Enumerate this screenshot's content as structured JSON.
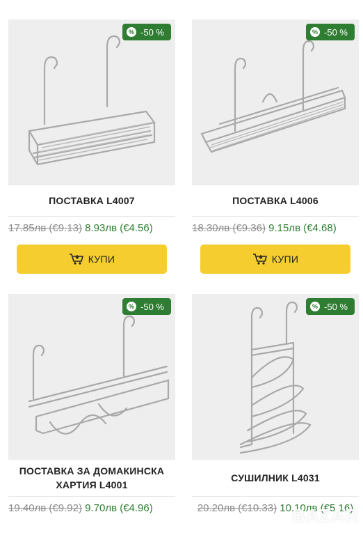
{
  "colors": {
    "badge": "#2e7d32",
    "buy_button": "#f6cd2f",
    "new_price": "#2e7d32",
    "old_price": "#8a8a8a"
  },
  "products": [
    {
      "badge": "-50 %",
      "title": "ПОСТАВКА L4007",
      "old_price": "17.85лв (€9.13)",
      "new_price": "8.93лв (€4.56)",
      "buy_label": "КУПИ"
    },
    {
      "badge": "-50 %",
      "title": "ПОСТАВКА L4006",
      "old_price": "18.30лв (€9.36)",
      "new_price": "9.15лв (€4.68)",
      "buy_label": "КУПИ"
    },
    {
      "badge": "-50 %",
      "title": "ПОСТАВКА ЗА ДОМАКИНСКА ХАРТИЯ L4001",
      "old_price": "19.40лв (€9.92)",
      "new_price": "9.70лв (€4.96)"
    },
    {
      "badge": "-50 %",
      "title": "СУШИЛНИК L4031",
      "old_price": "20.20лв (€10.33)",
      "new_price": "10.10лв (€5.16)"
    }
  ],
  "icons": {
    "badge": "percent-icon",
    "buy": "cart-icon"
  },
  "watermark": "BAZAR"
}
